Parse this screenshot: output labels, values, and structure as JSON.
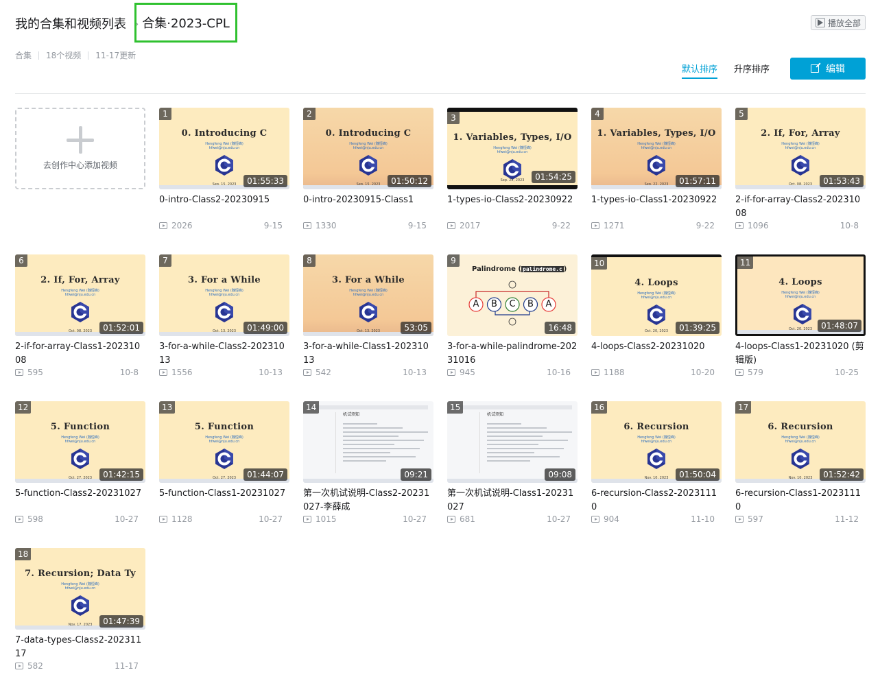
{
  "header": {
    "breadcrumb_root": "我的合集和视频列表",
    "breadcrumb_sep": "›",
    "collection_title": "合集·2023-CPL",
    "play_all_label": "播放全部"
  },
  "meta": {
    "type": "合集",
    "count": "18个视频",
    "updated": "11-17更新"
  },
  "toolbar": {
    "sort_default": "默认排序",
    "sort_ascending": "升序排序",
    "edit_label": "编辑"
  },
  "add_card": {
    "label": "去创作中心添加视频"
  },
  "videos": [
    {
      "index": "1",
      "duration": "01:55:33",
      "title": "0-intro-Class2-20230915",
      "views": "2026",
      "date": "9-15",
      "slide": "0. Introducing C",
      "slide_date": "Sep. 15, 2023"
    },
    {
      "index": "2",
      "duration": "01:50:12",
      "title": "0-intro-20230915-Class1",
      "views": "1330",
      "date": "9-15",
      "slide": "0. Introducing C",
      "slide_date": "Sep. 15, 2023"
    },
    {
      "index": "3",
      "duration": "01:54:25",
      "title": "1-types-io-Class2-20230922",
      "views": "2017",
      "date": "9-22",
      "slide": "1. Variables, Types, I/O",
      "slide_date": "Sep. 22, 2023"
    },
    {
      "index": "4",
      "duration": "01:57:11",
      "title": "1-types-io-Class1-20230922",
      "views": "1271",
      "date": "9-22",
      "slide": "1. Variables, Types, I/O",
      "slide_date": "Sep. 22, 2023"
    },
    {
      "index": "5",
      "duration": "01:53:43",
      "title": "2-if-for-array-Class2-20231008",
      "views": "1096",
      "date": "10-8",
      "slide": "2. If, For, Array",
      "slide_date": "Oct. 08, 2023"
    },
    {
      "index": "6",
      "duration": "01:52:01",
      "title": "2-if-for-array-Class1-20231008",
      "views": "595",
      "date": "10-8",
      "slide": "2. If, For, Array",
      "slide_date": "Oct. 08, 2023"
    },
    {
      "index": "7",
      "duration": "01:49:00",
      "title": "3-for-a-while-Class2-20231013",
      "views": "1556",
      "date": "10-13",
      "slide": "3. For a While",
      "slide_date": "Oct. 13, 2023"
    },
    {
      "index": "8",
      "duration": "53:05",
      "title": "3-for-a-while-Class1-20231013",
      "views": "542",
      "date": "10-13",
      "slide": "3. For a While",
      "slide_date": "Oct. 13, 2023"
    },
    {
      "index": "9",
      "duration": "16:48",
      "title": "3-for-a-while-palindrome-20231016",
      "views": "945",
      "date": "10-16",
      "slide": "Palindrome (",
      "slide_code": "palindrome.c",
      "slide_close": ")",
      "letters": [
        "A",
        "B",
        "C",
        "B",
        "A"
      ]
    },
    {
      "index": "10",
      "duration": "01:39:25",
      "title": "4-loops-Class2-20231020",
      "views": "1188",
      "date": "10-20",
      "slide": "4. Loops",
      "slide_date": "Oct. 20, 2023"
    },
    {
      "index": "11",
      "duration": "01:48:07",
      "title": "4-loops-Class1-20231020 (剪辑版)",
      "views": "579",
      "date": "10-25",
      "slide": "4. Loops",
      "slide_date": "Oct. 20, 2023"
    },
    {
      "index": "12",
      "duration": "01:42:15",
      "title": "5-function-Class2-20231027",
      "views": "598",
      "date": "10-27",
      "slide": "5. Function",
      "slide_date": "Oct. 27, 2023"
    },
    {
      "index": "13",
      "duration": "01:44:07",
      "title": "5-function-Class1-20231027",
      "views": "1128",
      "date": "10-27",
      "slide": "5. Function",
      "slide_date": "Oct. 27, 2023"
    },
    {
      "index": "14",
      "duration": "09:21",
      "title": "第一次机试说明-Class2-20231027-李薛成",
      "views": "1015",
      "date": "10-27",
      "slide": "机试须知"
    },
    {
      "index": "15",
      "duration": "09:08",
      "title": "第一次机试说明-Class1-20231027",
      "views": "681",
      "date": "10-27",
      "slide": "机试须知"
    },
    {
      "index": "16",
      "duration": "01:50:04",
      "title": "6-recursion-Class2-20231110",
      "views": "904",
      "date": "11-10",
      "slide": "6. Recursion",
      "slide_date": "Nov. 10, 2023"
    },
    {
      "index": "17",
      "duration": "01:52:42",
      "title": "6-recursion-Class1-20231110",
      "views": "597",
      "date": "11-12",
      "slide": "6. Recursion",
      "slide_date": "Nov. 10, 2023"
    },
    {
      "index": "18",
      "duration": "01:47:39",
      "title": "7-data-types-Class2-20231117",
      "views": "582",
      "date": "11-17",
      "slide": "7. Recursion; Data Ty",
      "slide_date": "Nov. 17, 2023"
    }
  ],
  "slide_author": "Hengfeng Wei (魏恒峰)",
  "slide_email": "hfwei@nju.edu.cn",
  "colors": {
    "accent": "#00a1d6",
    "highlight_border": "#2fc12f",
    "slide_bg": "#fdebbf"
  }
}
